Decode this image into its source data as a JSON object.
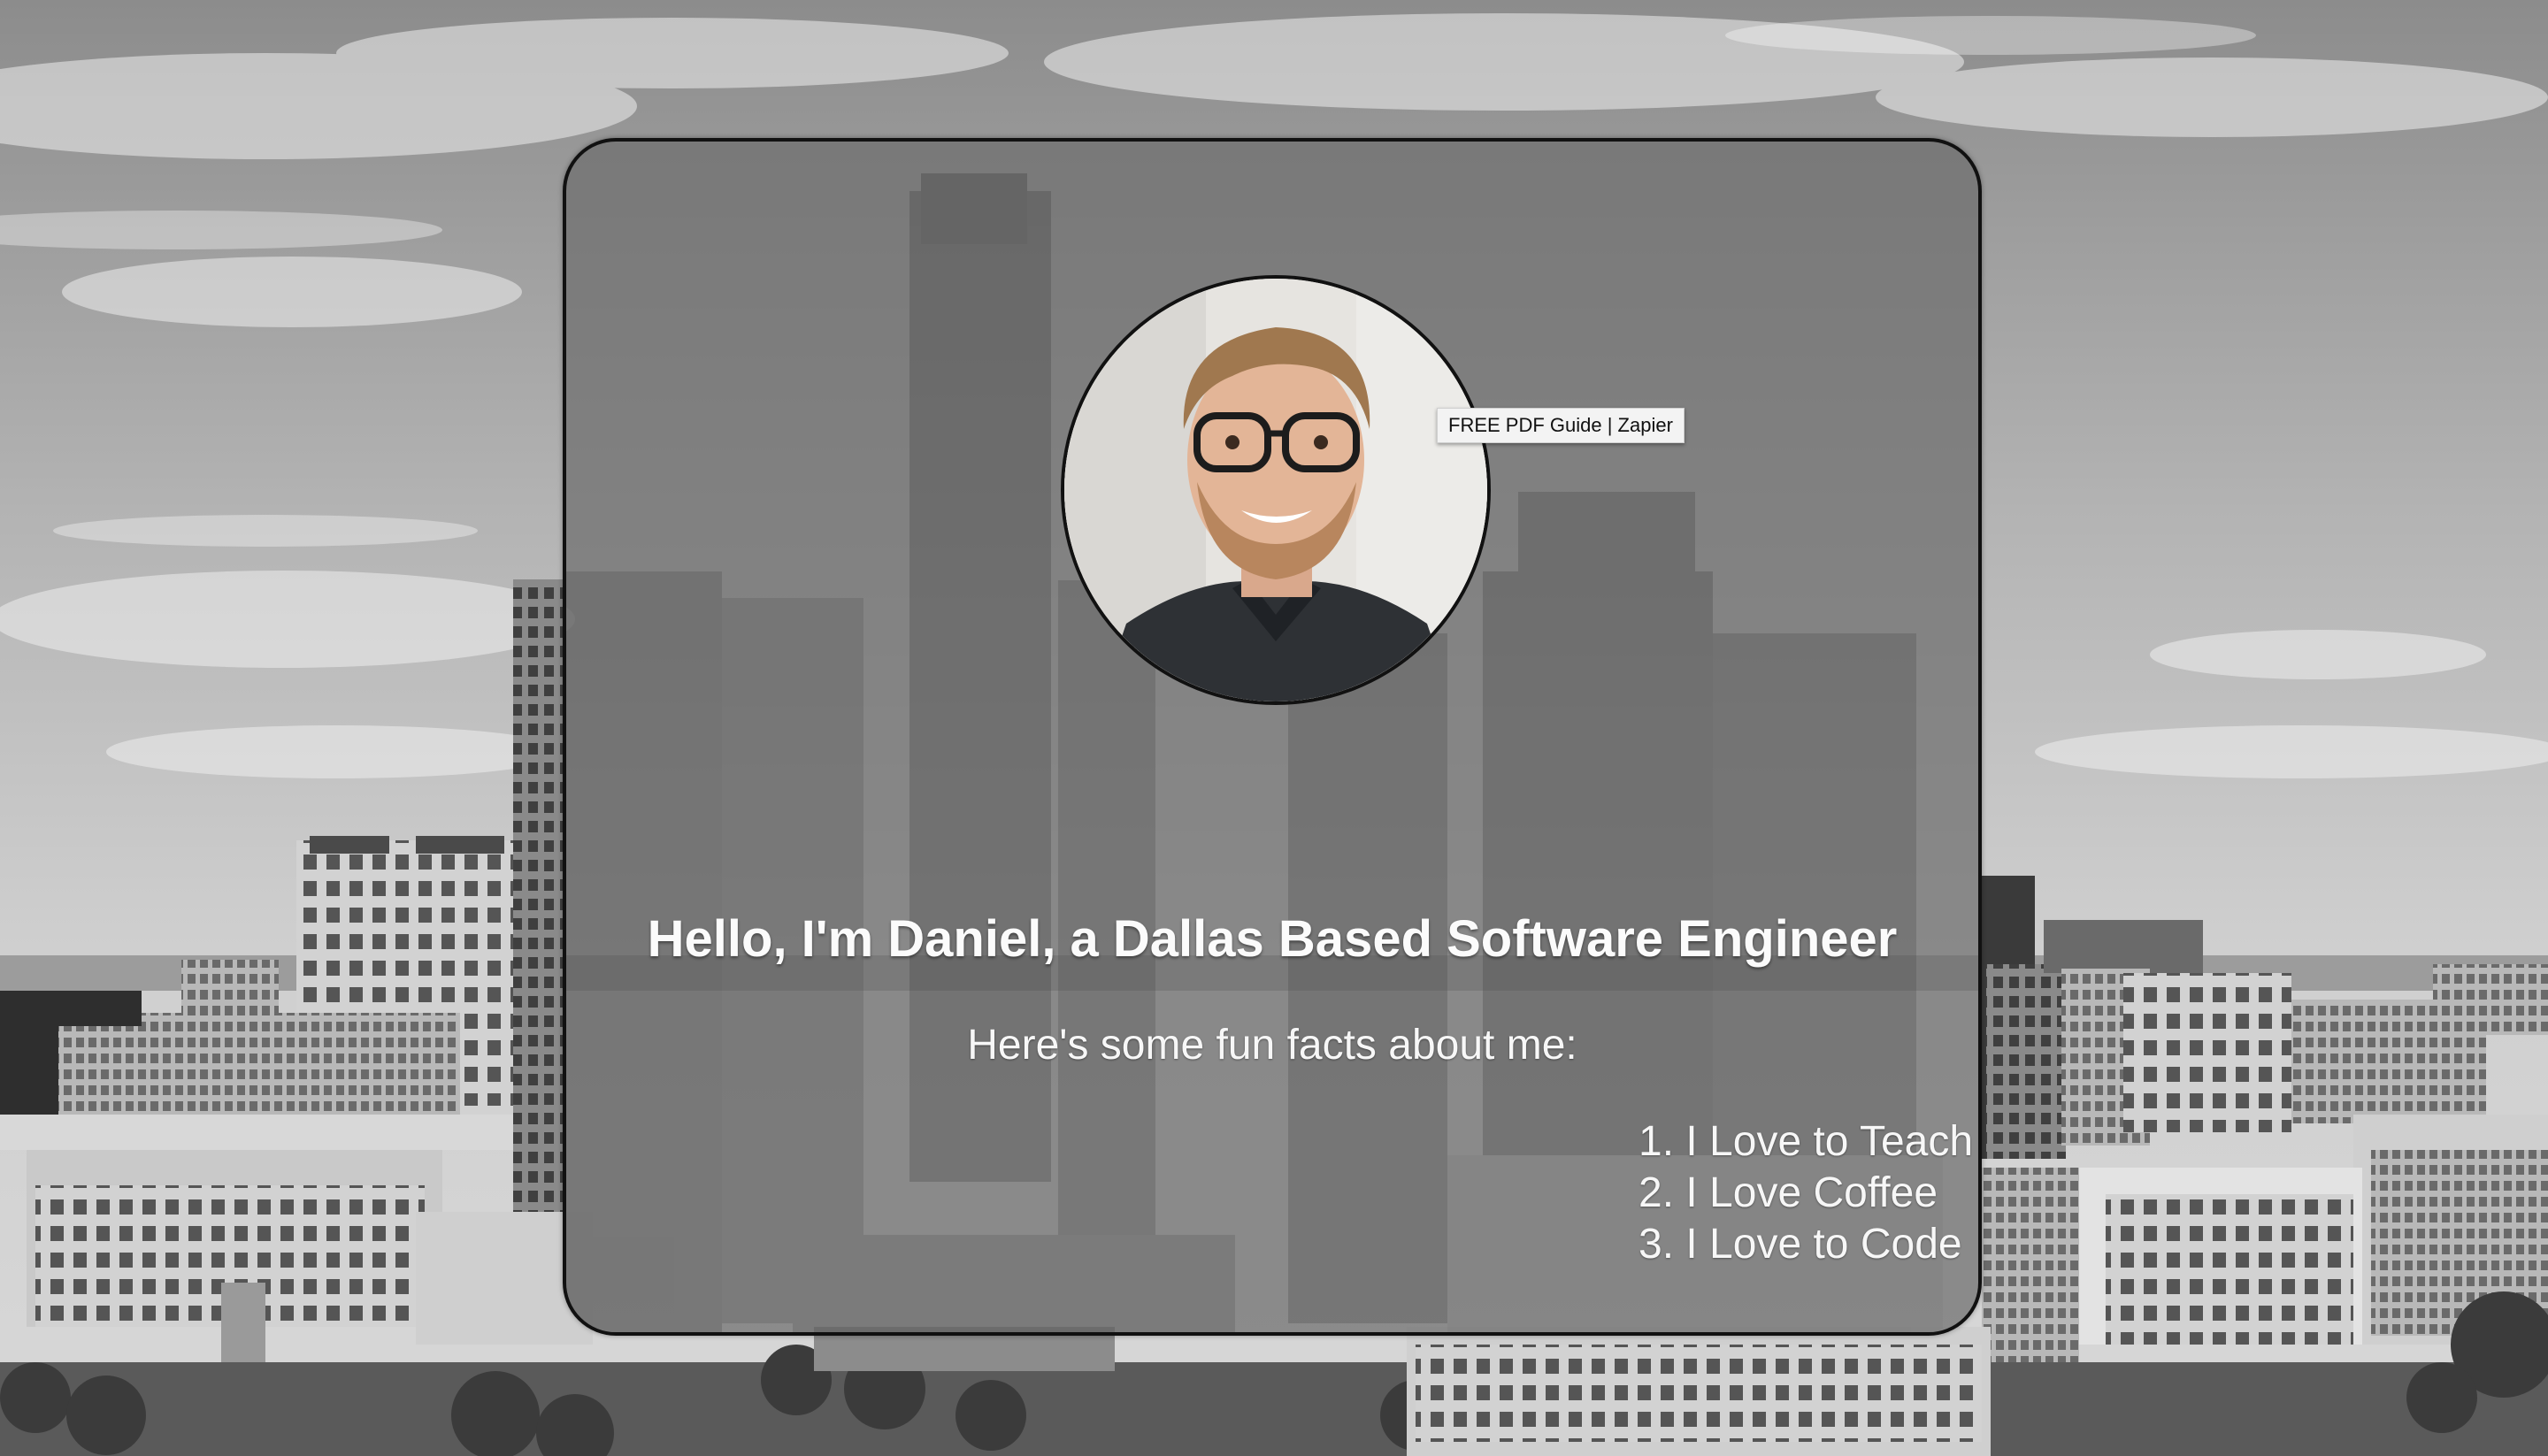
{
  "tooltip": {
    "text": "FREE PDF Guide | Zapier"
  },
  "intro": {
    "headline": "Hello, I'm Daniel, a Dallas Based Software Engineer",
    "subheading": "Here's some fun facts about me:",
    "facts": [
      {
        "number": "1.",
        "text": "I Love to Teach"
      },
      {
        "number": "2.",
        "text": "I Love Coffee"
      },
      {
        "number": "3.",
        "text": "I Love to Code"
      }
    ]
  },
  "colors": {
    "card_overlay": "#6e6e6e",
    "card_border": "#111111",
    "text": "#ffffff"
  },
  "icons": {
    "avatar": "profile-photo-man-glasses"
  }
}
